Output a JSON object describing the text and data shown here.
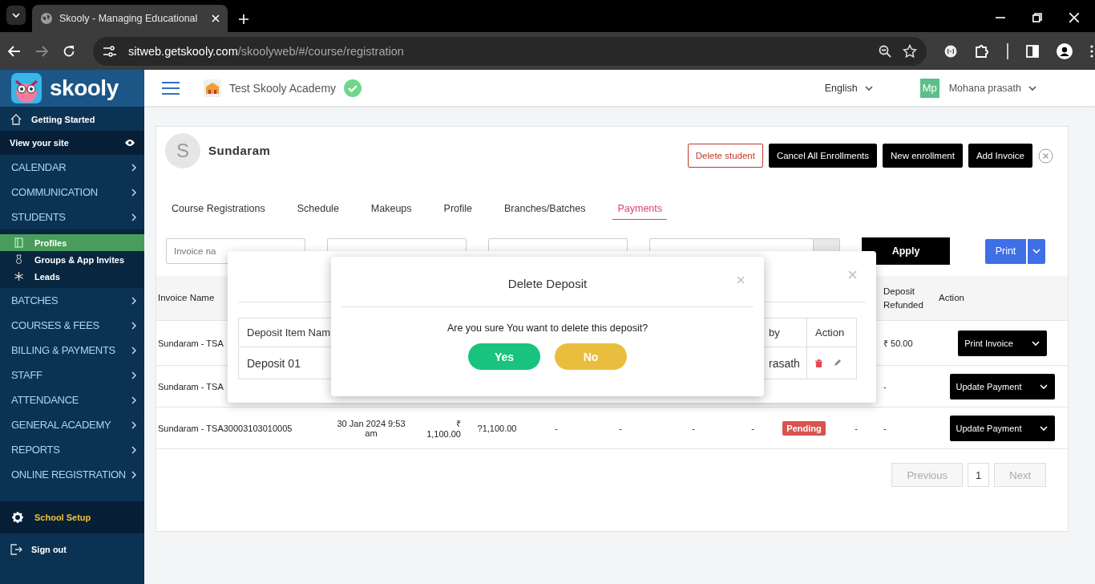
{
  "browser": {
    "tab_title": "Skooly - Managing Educational",
    "url_host": "sitweb.getskooly.com",
    "url_path": "/skoolyweb/#/course/registration"
  },
  "header": {
    "academy": "Test Skooly Academy",
    "language": "English",
    "user_initials": "Mp",
    "user_name": "Mohana prasath"
  },
  "sidebar": {
    "logo": "skooly",
    "items": [
      {
        "kind": "start",
        "label": "Getting Started"
      },
      {
        "kind": "site",
        "label": "View your site"
      },
      {
        "kind": "menu",
        "label": "CALENDAR"
      },
      {
        "kind": "menu",
        "label": "COMMUNICATION"
      },
      {
        "kind": "menu",
        "label": "STUDENTS",
        "children": [
          {
            "kind": "profiles",
            "label": "Profiles",
            "selected": true
          },
          {
            "kind": "groups",
            "label": "Groups & App Invites",
            "selected": false
          },
          {
            "kind": "leads",
            "label": "Leads",
            "selected": false
          }
        ]
      },
      {
        "kind": "menu",
        "label": "BATCHES"
      },
      {
        "kind": "menu",
        "label": "COURSES & FEES"
      },
      {
        "kind": "menu",
        "label": "BILLING & PAYMENTS"
      },
      {
        "kind": "menu",
        "label": "STAFF"
      },
      {
        "kind": "menu",
        "label": "ATTENDANCE"
      },
      {
        "kind": "menu",
        "label": "GENERAL ACADEMY"
      },
      {
        "kind": "menu",
        "label": "REPORTS"
      },
      {
        "kind": "menu",
        "label": "ONLINE REGISTRATION"
      },
      {
        "kind": "setup",
        "label": "School Setup"
      },
      {
        "kind": "signout",
        "label": "Sign out"
      }
    ]
  },
  "student": {
    "initial": "S",
    "name": "Sundaram",
    "actions": [
      {
        "kind": "outline",
        "label": "Delete student"
      },
      {
        "kind": "solid",
        "label": "Cancel All Enrollments"
      },
      {
        "kind": "solid",
        "label": "New enrollment"
      },
      {
        "kind": "solid",
        "label": "Add Invoice"
      }
    ],
    "tabs": [
      {
        "label": "Course Registrations",
        "selected": false
      },
      {
        "label": "Schedule",
        "selected": false
      },
      {
        "label": "Makeups",
        "selected": false
      },
      {
        "label": "Profile",
        "selected": false
      },
      {
        "label": "Branches/Batches",
        "selected": false
      },
      {
        "label": "Payments",
        "selected": true
      }
    ]
  },
  "filters": [
    {
      "kind": "text",
      "placeholder": "Invoice na"
    },
    {
      "kind": "blank"
    },
    {
      "kind": "blank"
    },
    {
      "kind": "addon"
    }
  ],
  "apply": "Apply",
  "print": "Print",
  "table": {
    "columns": [
      {
        "kind": "invoice",
        "label": "Invoice Name"
      },
      {
        "kind": "refunded",
        "label": "Deposit Refunded"
      },
      {
        "kind": "action",
        "label": "Action"
      }
    ],
    "rows": [
      {
        "invoice": "Sundaram - TSA",
        "refunded": "₹ 50.00",
        "action": "Print Invoice"
      },
      {
        "invoice": "Sundaram - TSA",
        "refunded": "-",
        "action": "Update Payment"
      },
      {
        "invoice": "Sundaram - TSA30003103010005",
        "date": "30 Jan 2024 9:53 am",
        "amount": "₹ 1,100.00",
        "paid": "?1,100.00",
        "column_5": "-",
        "column_6": "-",
        "column_7": "-",
        "column_8": "-",
        "status": "Pending",
        "column_10": "-",
        "refunded": "-",
        "action": "Update Payment"
      }
    ]
  },
  "pagination": {
    "previous": {
      "label": "Previous",
      "disabled": true
    },
    "page": "1",
    "next": {
      "label": "Next",
      "disabled": true
    }
  },
  "deposit_modal": {
    "columns": [
      "Deposit Item Nam",
      "by",
      "Action"
    ],
    "rows": [
      {
        "item": "Deposit 01",
        "by": "rasath"
      }
    ]
  },
  "confirm_modal": {
    "title": "Delete Deposit",
    "message": "Are you sure You want to delete this deposit?",
    "yes": "Yes",
    "no": "No"
  }
}
